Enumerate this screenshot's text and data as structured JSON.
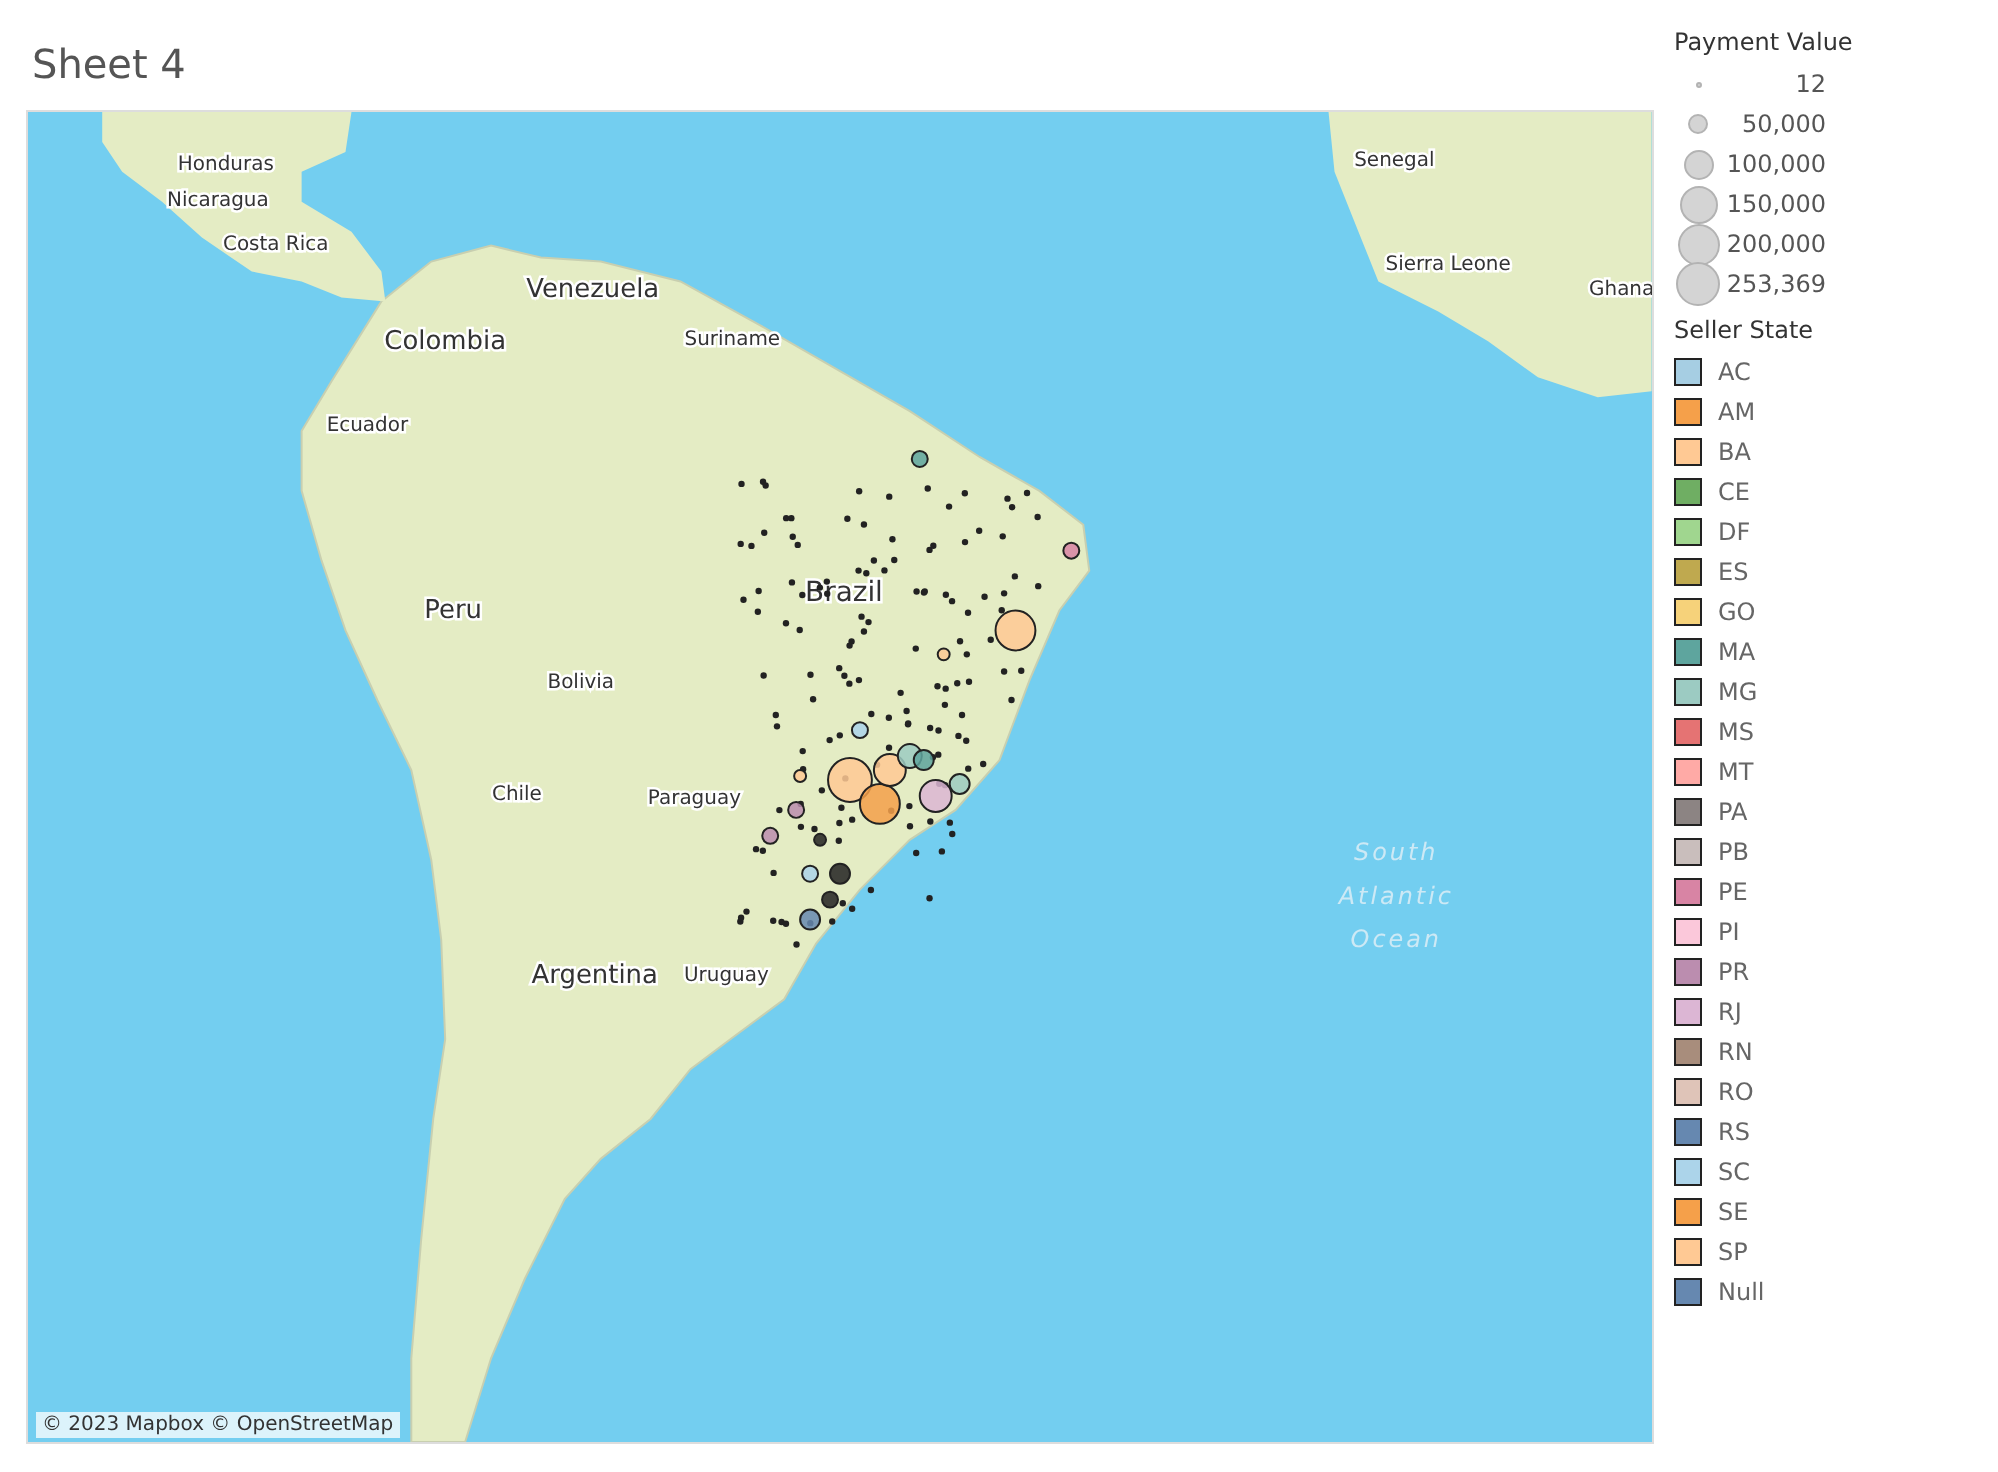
{
  "title": "Sheet 4",
  "map": {
    "labels": [
      "Honduras",
      "Nicaragua",
      "Costa Rica",
      "Venezuela",
      "Colombia",
      "Suriname",
      "Ecuador",
      "Brazil",
      "Peru",
      "Bolivia",
      "Chile",
      "Paraguay",
      "Argentina",
      "Uruguay",
      "Senegal",
      "Sierra Leone",
      "Ghana"
    ],
    "ocean_label": [
      "South",
      "Atlantic",
      "Ocean"
    ],
    "attribution": "© 2023 Mapbox © OpenStreetMap"
  },
  "size_legend": {
    "title": "Payment Value",
    "items": [
      "12",
      "50,000",
      "100,000",
      "150,000",
      "200,000",
      "253,369"
    ]
  },
  "color_legend": {
    "title": "Seller State",
    "items": [
      {
        "label": "AC",
        "color": "#a6cee3"
      },
      {
        "label": "AM",
        "color": "#f5a04a"
      },
      {
        "label": "BA",
        "color": "#ffc994"
      },
      {
        "label": "CE",
        "color": "#6fae63"
      },
      {
        "label": "DF",
        "color": "#a0d68f"
      },
      {
        "label": "ES",
        "color": "#bfa94f"
      },
      {
        "label": "GO",
        "color": "#f6d27a"
      },
      {
        "label": "MA",
        "color": "#5ea59e"
      },
      {
        "label": "MG",
        "color": "#9ccbc2"
      },
      {
        "label": "MS",
        "color": "#e57373"
      },
      {
        "label": "MT",
        "color": "#ffaaa6"
      },
      {
        "label": "PA",
        "color": "#8c8483"
      },
      {
        "label": "PB",
        "color": "#c9bebc"
      },
      {
        "label": "PE",
        "color": "#d884a4"
      },
      {
        "label": "PI",
        "color": "#fbc8da"
      },
      {
        "label": "PR",
        "color": "#bb8daf"
      },
      {
        "label": "RJ",
        "color": "#dcb6d4"
      },
      {
        "label": "RN",
        "color": "#a88d7c"
      },
      {
        "label": "RO",
        "color": "#dfc4b8"
      },
      {
        "label": "RS",
        "color": "#6688b0"
      },
      {
        "label": "SC",
        "color": "#acd4ea"
      },
      {
        "label": "SE",
        "color": "#f5a04a"
      },
      {
        "label": "SP",
        "color": "#ffc994"
      },
      {
        "label": "Null",
        "color": "#6688b0"
      }
    ]
  }
}
